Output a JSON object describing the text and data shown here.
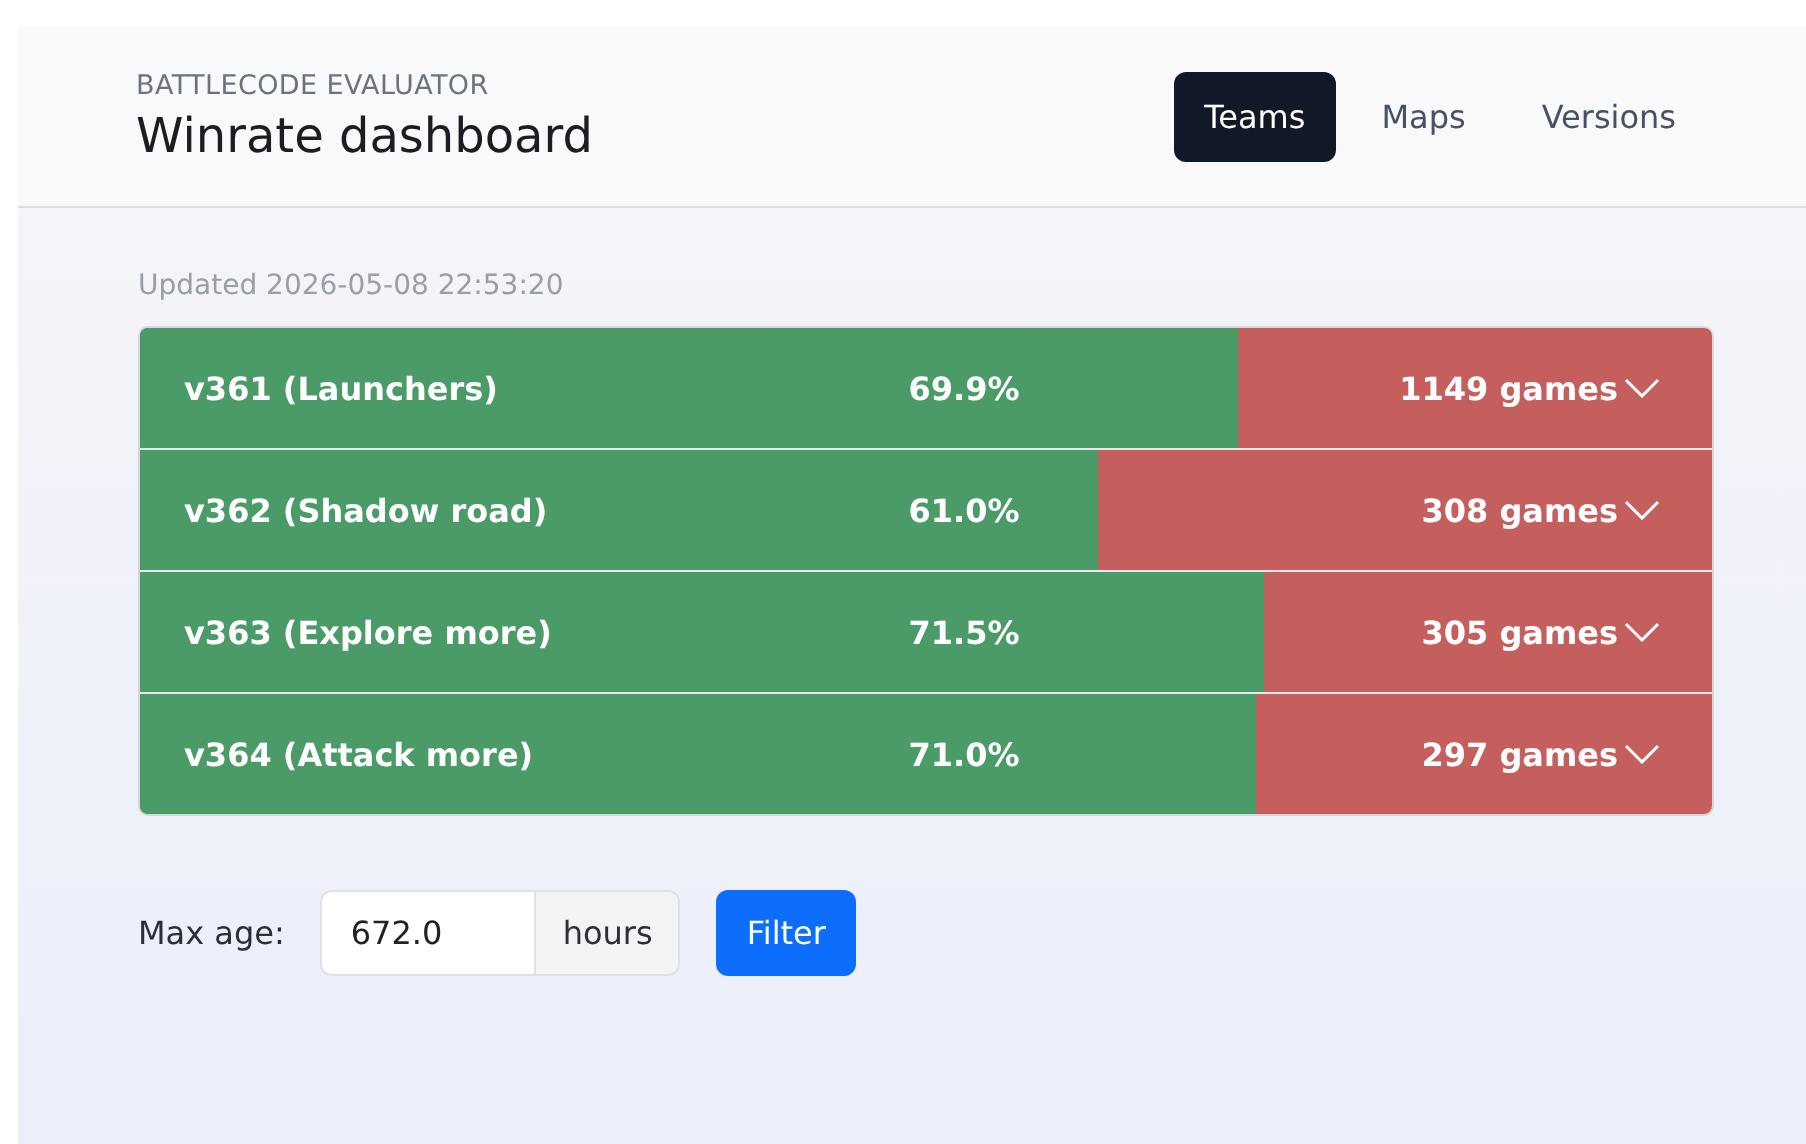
{
  "header": {
    "subtitle": "BATTLECODE EVALUATOR",
    "title": "Winrate dashboard"
  },
  "tabs": [
    {
      "label": "Teams",
      "selected": true
    },
    {
      "label": "Maps",
      "selected": false
    },
    {
      "label": "Versions",
      "selected": false
    }
  ],
  "updated": "Updated 2026-05-08 22:53:20",
  "rows": [
    {
      "name": "v361 (Launchers)",
      "winrate": "69.9%",
      "level": 0.699,
      "games": "1149 games"
    },
    {
      "name": "v362 (Shadow road)",
      "winrate": "61.0%",
      "level": 0.61,
      "games": "308 games"
    },
    {
      "name": "v363 (Explore more)",
      "winrate": "71.5%",
      "level": 0.715,
      "games": "305 games"
    },
    {
      "name": "v364 (Attack more)",
      "winrate": "71.0%",
      "level": 0.71,
      "games": "297 games"
    }
  ],
  "filter": {
    "label": "Max age:",
    "value": "672.0",
    "unit": "hours",
    "button": "Filter"
  }
}
